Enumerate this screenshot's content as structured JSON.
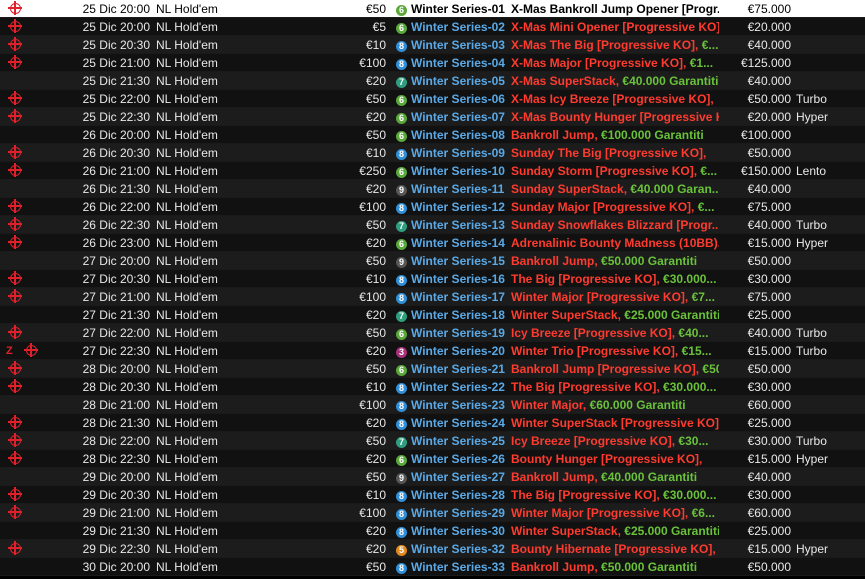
{
  "colors": {
    "series_blue": "#5aa9e6",
    "name_red": "#ff3b2f",
    "guaranteed_green": "#69c23a",
    "icon_red": "#e0202a",
    "selected_row": "#ffffff",
    "badge_6": "#5aa83a",
    "badge_7": "#2e9e7e",
    "badge_8": "#2f8fd8",
    "badge_9": "#555555",
    "badge_3": "#a8307a",
    "badge_5": "#e08a1e"
  },
  "rows": [
    {
      "target": true,
      "zap": false,
      "date": "25 Dic  20:00",
      "game": "NL Hold'em",
      "buyin": "€50",
      "badge": "6",
      "series": "Winter Series-01",
      "name": "X-Mas Bankroll Jump Opener [Progr...",
      "gtd": "",
      "prize": "€75.000",
      "type": "",
      "selected": true
    },
    {
      "target": true,
      "zap": false,
      "date": "25 Dic  20:00",
      "game": "NL Hold'em",
      "buyin": "€5",
      "badge": "6",
      "series": "Winter Series-02",
      "name": "X-Mas Mini Opener [Progressive KO],",
      "gtd": "",
      "prize": "€20.000",
      "type": ""
    },
    {
      "target": true,
      "zap": false,
      "date": "25 Dic  20:30",
      "game": "NL Hold'em",
      "buyin": "€10",
      "badge": "8",
      "series": "Winter Series-03",
      "name": "X-Mas The Big [Progressive KO],",
      "gtd": "€...",
      "prize": "€40.000",
      "type": ""
    },
    {
      "target": true,
      "zap": false,
      "date": "25 Dic  21:00",
      "game": "NL Hold'em",
      "buyin": "€100",
      "badge": "8",
      "series": "Winter Series-04",
      "name": "X-Mas Major [Progressive KO],",
      "gtd": "€1...",
      "prize": "€125.000",
      "type": ""
    },
    {
      "target": false,
      "zap": false,
      "date": "25 Dic  21:30",
      "game": "NL Hold'em",
      "buyin": "€20",
      "badge": "7",
      "series": "Winter Series-05",
      "name": "X-Mas SuperStack,",
      "gtd": "€40.000 Garantiti",
      "prize": "€40.000",
      "type": ""
    },
    {
      "target": true,
      "zap": false,
      "date": "25 Dic  22:00",
      "game": "NL Hold'em",
      "buyin": "€50",
      "badge": "6",
      "series": "Winter Series-06",
      "name": "X-Mas Icy Breeze [Progressive KO],",
      "gtd": "",
      "prize": "€50.000",
      "type": "Turbo"
    },
    {
      "target": true,
      "zap": false,
      "date": "25 Dic  22:30",
      "game": "NL Hold'em",
      "buyin": "€20",
      "badge": "6",
      "series": "Winter Series-07",
      "name": "X-Mas Bounty Hunger [Progressive KO],",
      "gtd": "",
      "prize": "€20.000",
      "type": "Hyper"
    },
    {
      "target": false,
      "zap": false,
      "date": "26 Dic  20:00",
      "game": "NL Hold'em",
      "buyin": "€50",
      "badge": "6",
      "series": "Winter Series-08",
      "name": "Bankroll Jump,",
      "gtd": "€100.000 Garantiti",
      "prize": "€100.000",
      "type": ""
    },
    {
      "target": true,
      "zap": false,
      "date": "26 Dic  20:30",
      "game": "NL Hold'em",
      "buyin": "€10",
      "badge": "8",
      "series": "Winter Series-09",
      "name": "Sunday The Big [Progressive KO],",
      "gtd": "",
      "prize": "€50.000",
      "type": ""
    },
    {
      "target": true,
      "zap": false,
      "date": "26 Dic  21:00",
      "game": "NL Hold'em",
      "buyin": "€250",
      "badge": "6",
      "series": "Winter Series-10",
      "name": "Sunday Storm [Progressive KO],",
      "gtd": "€...",
      "prize": "€150.000",
      "type": "Lento"
    },
    {
      "target": false,
      "zap": false,
      "date": "26 Dic  21:30",
      "game": "NL Hold'em",
      "buyin": "€20",
      "badge": "9",
      "series": "Winter Series-11",
      "name": "Sunday SuperStack,",
      "gtd": "€40.000 Garan...",
      "prize": "€40.000",
      "type": ""
    },
    {
      "target": true,
      "zap": false,
      "date": "26 Dic  22:00",
      "game": "NL Hold'em",
      "buyin": "€100",
      "badge": "8",
      "series": "Winter Series-12",
      "name": "Sunday Major [Progressive KO],",
      "gtd": "€...",
      "prize": "€75.000",
      "type": ""
    },
    {
      "target": true,
      "zap": false,
      "date": "26 Dic  22:30",
      "game": "NL Hold'em",
      "buyin": "€50",
      "badge": "7",
      "series": "Winter Series-13",
      "name": "Sunday Snowflakes Blizzard [Progr...",
      "gtd": "",
      "prize": "€40.000",
      "type": "Turbo"
    },
    {
      "target": true,
      "zap": false,
      "date": "26 Dic  23:00",
      "game": "NL Hold'em",
      "buyin": "€20",
      "badge": "6",
      "series": "Winter Series-14",
      "name": "Adrenalinic Bounty Madness (10BB)...",
      "gtd": "",
      "prize": "€15.000",
      "type": "Hyper"
    },
    {
      "target": false,
      "zap": false,
      "date": "27 Dic  20:00",
      "game": "NL Hold'em",
      "buyin": "€50",
      "badge": "9",
      "series": "Winter Series-15",
      "name": "Bankroll Jump,",
      "gtd": "€50.000 Garantiti",
      "prize": "€50.000",
      "type": ""
    },
    {
      "target": true,
      "zap": false,
      "date": "27 Dic  20:30",
      "game": "NL Hold'em",
      "buyin": "€10",
      "badge": "8",
      "series": "Winter Series-16",
      "name": "The Big [Progressive KO],",
      "gtd": "€30.000...",
      "prize": "€30.000",
      "type": ""
    },
    {
      "target": true,
      "zap": false,
      "date": "27 Dic  21:00",
      "game": "NL Hold'em",
      "buyin": "€100",
      "badge": "8",
      "series": "Winter Series-17",
      "name": "Winter Major [Progressive KO],",
      "gtd": "€7...",
      "prize": "€75.000",
      "type": ""
    },
    {
      "target": false,
      "zap": false,
      "date": "27 Dic  21:30",
      "game": "NL Hold'em",
      "buyin": "€20",
      "badge": "7",
      "series": "Winter Series-18",
      "name": "Winter SuperStack,",
      "gtd": "€25.000 Garantiti",
      "prize": "€25.000",
      "type": ""
    },
    {
      "target": true,
      "zap": false,
      "date": "27 Dic  22:00",
      "game": "NL Hold'em",
      "buyin": "€50",
      "badge": "6",
      "series": "Winter Series-19",
      "name": "Icy Breeze [Progressive KO],",
      "gtd": "€40...",
      "prize": "€40.000",
      "type": "Turbo"
    },
    {
      "target": true,
      "zap": true,
      "date": "27 Dic  22:30",
      "game": "NL Hold'em",
      "buyin": "€20",
      "badge": "3",
      "series": "Winter Series-20",
      "name": "Winter Trio [Progressive KO],",
      "gtd": "€15...",
      "prize": "€15.000",
      "type": "Turbo"
    },
    {
      "target": true,
      "zap": false,
      "date": "28 Dic  20:00",
      "game": "NL Hold'em",
      "buyin": "€50",
      "badge": "6",
      "series": "Winter Series-21",
      "name": "Bankroll Jump [Progressive KO],",
      "gtd": "€50...",
      "prize": "€50.000",
      "type": ""
    },
    {
      "target": true,
      "zap": false,
      "date": "28 Dic  20:30",
      "game": "NL Hold'em",
      "buyin": "€10",
      "badge": "8",
      "series": "Winter Series-22",
      "name": "The Big [Progressive KO],",
      "gtd": "€30.000...",
      "prize": "€30.000",
      "type": ""
    },
    {
      "target": false,
      "zap": false,
      "date": "28 Dic  21:00",
      "game": "NL Hold'em",
      "buyin": "€100",
      "badge": "8",
      "series": "Winter Series-23",
      "name": "Winter Major,",
      "gtd": "€60.000 Garantiti",
      "prize": "€60.000",
      "type": ""
    },
    {
      "target": true,
      "zap": false,
      "date": "28 Dic  21:30",
      "game": "NL Hold'em",
      "buyin": "€20",
      "badge": "8",
      "series": "Winter Series-24",
      "name": "Winter SuperStack [Progressive KO],",
      "gtd": "",
      "prize": "€25.000",
      "type": ""
    },
    {
      "target": true,
      "zap": false,
      "date": "28 Dic  22:00",
      "game": "NL Hold'em",
      "buyin": "€50",
      "badge": "7",
      "series": "Winter Series-25",
      "name": "Icy Breeze [Progressive KO],",
      "gtd": "€30...",
      "prize": "€30.000",
      "type": "Turbo"
    },
    {
      "target": true,
      "zap": false,
      "date": "28 Dic  22:30",
      "game": "NL Hold'em",
      "buyin": "€20",
      "badge": "6",
      "series": "Winter Series-26",
      "name": "Bounty Hunger [Progressive KO],",
      "gtd": "",
      "prize": "€15.000",
      "type": "Hyper"
    },
    {
      "target": false,
      "zap": false,
      "date": "29 Dic  20:00",
      "game": "NL Hold'em",
      "buyin": "€50",
      "badge": "9",
      "series": "Winter Series-27",
      "name": "Bankroll Jump,",
      "gtd": "€40.000 Garantiti",
      "prize": "€40.000",
      "type": ""
    },
    {
      "target": true,
      "zap": false,
      "date": "29 Dic  20:30",
      "game": "NL Hold'em",
      "buyin": "€10",
      "badge": "8",
      "series": "Winter Series-28",
      "name": "The Big [Progressive KO],",
      "gtd": "€30.000...",
      "prize": "€30.000",
      "type": ""
    },
    {
      "target": true,
      "zap": false,
      "date": "29 Dic  21:00",
      "game": "NL Hold'em",
      "buyin": "€100",
      "badge": "8",
      "series": "Winter Series-29",
      "name": "Winter Major [Progressive KO],",
      "gtd": "€6...",
      "prize": "€60.000",
      "type": ""
    },
    {
      "target": false,
      "zap": false,
      "date": "29 Dic  21:30",
      "game": "NL Hold'em",
      "buyin": "€20",
      "badge": "8",
      "series": "Winter Series-30",
      "name": "Winter SuperStack,",
      "gtd": "€25.000 Garantiti",
      "prize": "€25.000",
      "type": ""
    },
    {
      "target": true,
      "zap": false,
      "date": "29 Dic  22:30",
      "game": "NL Hold'em",
      "buyin": "€20",
      "badge": "5",
      "series": "Winter Series-32",
      "name": "Bounty Hibernate [Progressive KO],",
      "gtd": "",
      "prize": "€15.000",
      "type": "Hyper"
    },
    {
      "target": false,
      "zap": false,
      "date": "30 Dic  20:00",
      "game": "NL Hold'em",
      "buyin": "€50",
      "badge": "8",
      "series": "Winter Series-33",
      "name": "Bankroll Jump,",
      "gtd": "€50.000 Garantiti",
      "prize": "€50.000",
      "type": ""
    }
  ]
}
